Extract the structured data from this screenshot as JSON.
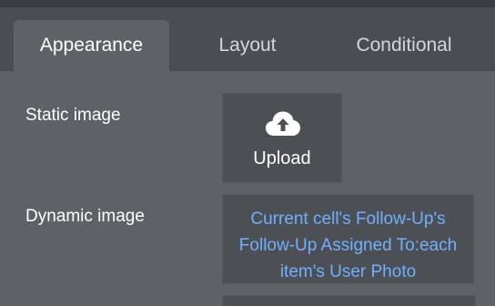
{
  "tabs": [
    {
      "label": "Appearance",
      "active": true
    },
    {
      "label": "Layout",
      "active": false
    },
    {
      "label": "Conditional",
      "active": false
    }
  ],
  "fields": {
    "static_image": {
      "label": "Static image",
      "button_label": "Upload",
      "icon": "cloud-upload-icon"
    },
    "dynamic_image": {
      "label": "Dynamic image",
      "value": "Current cell's Follow-Up's Follow-Up Assigned To:each item's User Photo"
    }
  },
  "colors": {
    "panel_bg": "#5e6266",
    "tabstrip_bg": "#4a4e52",
    "topbar_bg": "#3a3e42",
    "field_bg": "#4c5054",
    "expression_text": "#6fb0ff",
    "text": "#ffffff"
  }
}
